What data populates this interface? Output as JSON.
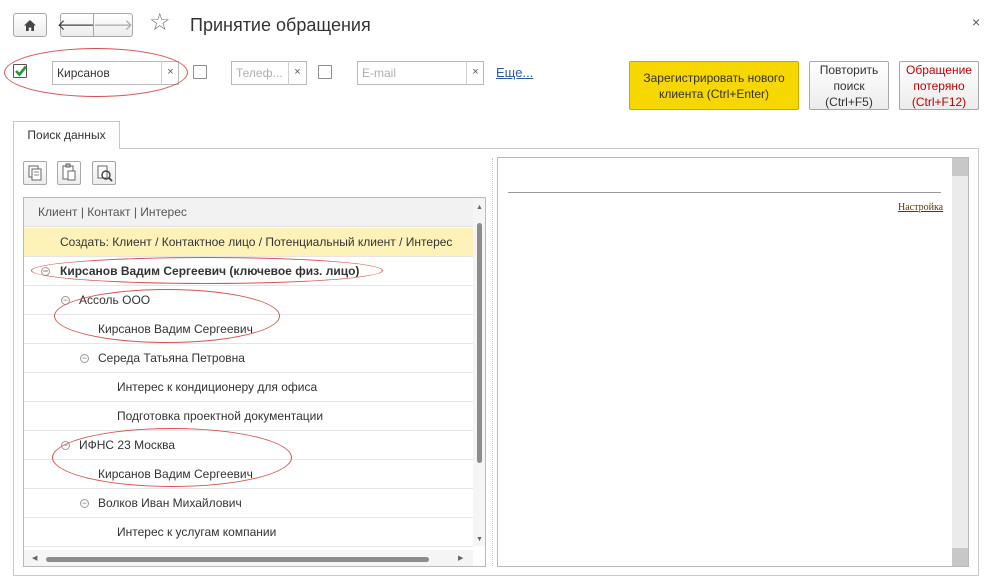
{
  "window": {
    "title": "Принятие обращения",
    "close_glyph": "×"
  },
  "nav": {
    "home_icon": "home-icon",
    "back_glyph": "🡐",
    "forward_glyph": "🡒",
    "star_glyph": "☆"
  },
  "filters": {
    "name_value": "Кирсанов",
    "phone_placeholder": "Телеф...",
    "email_placeholder": "E-mail",
    "clear_glyph": "×",
    "more_link": "Еще..."
  },
  "actions": {
    "register_label": "Зарегистрировать нового клиента (Ctrl+Enter)",
    "repeat_label": "Повторить поиск (Ctrl+F5)",
    "lost_label": "Обращение потеряно (Ctrl+F12)"
  },
  "tab": {
    "label": "Поиск данных"
  },
  "tree": {
    "header": "Клиент | Контакт | Интерес",
    "rows": [
      {
        "text": "Создать: Клиент / Контактное лицо / Потенциальный клиент / Интерес"
      },
      {
        "text": "Кирсанов Вадим Сергеевич (ключевое физ. лицо)"
      },
      {
        "text": "Ассоль ООО"
      },
      {
        "text": "Кирсанов Вадим Сергеевич"
      },
      {
        "text": "Середа Татьяна Петровна"
      },
      {
        "text": "Интерес к кондиционеру для офиса"
      },
      {
        "text": "Подготовка проектной документации"
      },
      {
        "text": "ИФНС 23 Москва"
      },
      {
        "text": "Кирсанов Вадим Сергеевич"
      },
      {
        "text": "Волков Иван Михайлович"
      },
      {
        "text": "Интерес к услугам компании"
      }
    ]
  },
  "right_panel": {
    "settings_link": "Настройка"
  },
  "colors": {
    "accent_yellow": "#f6d700",
    "create_row": "#fdf3b8",
    "annotation_red": "#d9534f",
    "lost_red": "#c00000"
  }
}
